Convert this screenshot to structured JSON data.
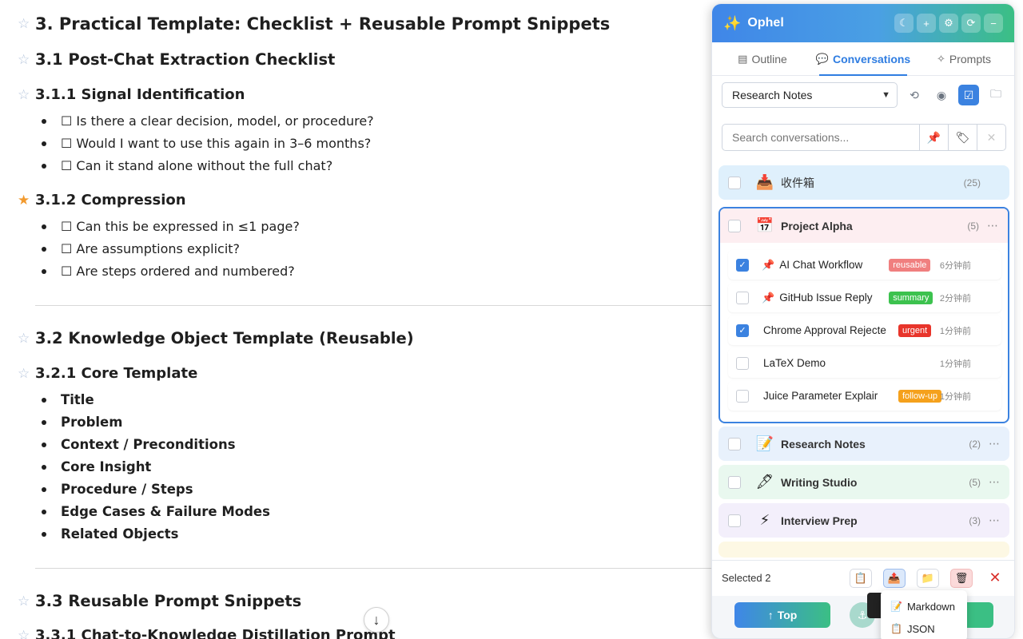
{
  "document": {
    "headings": [
      {
        "text": "3. Practical Template: Checklist + Reusable Prompt Snippets",
        "starred": false
      },
      {
        "text": "3.1 Post-Chat Extraction Checklist",
        "starred": false
      },
      {
        "text": "3.1.1 Signal Identification",
        "starred": false
      },
      {
        "text": "3.1.2 Compression",
        "starred": true
      },
      {
        "text": "3.2 Knowledge Object Template (Reusable)",
        "starred": false
      },
      {
        "text": "3.2.1 Core Template",
        "starred": false
      },
      {
        "text": "3.3 Reusable Prompt Snippets",
        "starred": false
      },
      {
        "text": "3.3.1 Chat-to-Knowledge Distillation Prompt",
        "starred": false
      }
    ],
    "signal_items": [
      "☐ Is there a clear decision, model, or procedure?",
      "☐ Would I want to use this again in 3–6 months?",
      "☐ Can it stand alone without the full chat?"
    ],
    "compression_items": [
      "☐ Can this be expressed in ≤1 page?",
      "☐ Are assumptions explicit?",
      "☐ Are steps ordered and numbered?"
    ],
    "template_items": [
      "Title",
      "Problem",
      "Context / Preconditions",
      "Core Insight",
      "Procedure / Steps",
      "Edge Cases & Failure Modes",
      "Related Objects"
    ]
  },
  "panel": {
    "title": "Ophel",
    "header_icons": [
      "moon-icon",
      "plus-icon",
      "gear-icon",
      "refresh-icon",
      "minimize-icon"
    ],
    "tabs": [
      {
        "label": "Outline",
        "icon": "document-icon",
        "active": false
      },
      {
        "label": "Conversations",
        "icon": "chat-icon",
        "active": true
      },
      {
        "label": "Prompts",
        "icon": "wand-icon",
        "active": false
      }
    ],
    "folder_select": "Research Notes",
    "search_placeholder": "Search conversations...",
    "folders": [
      {
        "name": "收件箱",
        "count": "(25)",
        "icon": "📥",
        "color": "#dff0fc",
        "bold": false
      },
      {
        "name": "Research Notes",
        "count": "(2)",
        "icon": "📝",
        "color": "#e8f1fc",
        "bold": true
      },
      {
        "name": "Writing Studio",
        "count": "(5)",
        "icon": "🖋",
        "color": "#e9f8ef",
        "bold": true
      },
      {
        "name": "Interview Prep",
        "count": "(3)",
        "icon": "⚡",
        "color": "#f3effb",
        "bold": true
      }
    ],
    "expanded_folder": {
      "name": "Project Alpha",
      "count": "(5)",
      "icon": "📅",
      "conversations": [
        {
          "name": "AI Chat Workflow",
          "pinned": true,
          "checked": true,
          "tag": "reusable",
          "tag_color": "#f07f7f",
          "time": "6分钟前"
        },
        {
          "name": "GitHub Issue Reply",
          "pinned": true,
          "checked": false,
          "tag": "summary",
          "tag_color": "#3cc24e",
          "time": "2分钟前"
        },
        {
          "name": "Chrome Approval Rejecte",
          "pinned": false,
          "checked": true,
          "tag": "urgent",
          "tag_color": "#e8352b",
          "time": "1分钟前"
        },
        {
          "name": "LaTeX Demo",
          "pinned": false,
          "checked": false,
          "tag": "",
          "tag_color": "",
          "time": "1分钟前"
        },
        {
          "name": "Juice Parameter Explair",
          "pinned": false,
          "checked": false,
          "tag": "follow-up",
          "tag_color": "#f5a11c",
          "time": "1分钟前"
        }
      ]
    },
    "selection": {
      "text": "Selected 2"
    },
    "bottom": {
      "top_label": "Top"
    },
    "export_menu": [
      "Markdown",
      "JSON"
    ]
  }
}
